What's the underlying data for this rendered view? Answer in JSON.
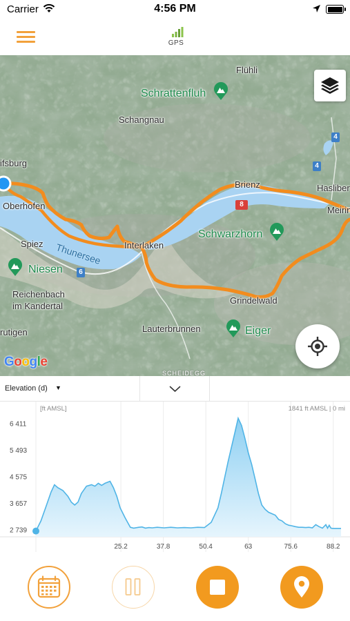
{
  "status_bar": {
    "carrier": "Carrier",
    "time": "4:56 PM"
  },
  "nav": {
    "gps_label": "GPS",
    "accent_color": "#f2a13b"
  },
  "map": {
    "attribution": "Google",
    "places": [
      {
        "id": "fluhli",
        "label": "Flühli"
      },
      {
        "id": "schangnau",
        "label": "Schangnau"
      },
      {
        "id": "sigriswil",
        "label": "ifsburg"
      },
      {
        "id": "oberhofen",
        "label": "Oberhofen"
      },
      {
        "id": "spiez",
        "label": "Spiez"
      },
      {
        "id": "interlaken",
        "label": "Interlaken"
      },
      {
        "id": "brienz",
        "label": "Brienz"
      },
      {
        "id": "hasliberg",
        "label": "Hasliber"
      },
      {
        "id": "meiringen",
        "label": "Meirin"
      },
      {
        "id": "reichenbach",
        "label": "Reichenbach\nim Kandertal"
      },
      {
        "id": "frutigen",
        "label": "rutigen"
      },
      {
        "id": "grindelwald",
        "label": "Grindelwald"
      },
      {
        "id": "lauterbrunnen",
        "label": "Lauterbrunnen"
      },
      {
        "id": "grosse-scheidegg",
        "label": "SCHEIDEGG"
      }
    ],
    "peaks": [
      {
        "id": "schrattenfluh",
        "label": "Schrattenfluh"
      },
      {
        "id": "schwarzhorn",
        "label": "Schwarzhorn"
      },
      {
        "id": "niesen",
        "label": "Niesen"
      },
      {
        "id": "eiger",
        "label": "Eiger"
      }
    ],
    "lake_label": "Thunersee",
    "road_shields": [
      {
        "id": "road-8",
        "label": "8"
      },
      {
        "id": "road-6",
        "label": "6"
      },
      {
        "id": "road-4a",
        "label": "4"
      },
      {
        "id": "road-4b",
        "label": "4"
      }
    ],
    "track_color": "#f28c1e",
    "icons": {
      "layers": "layers-icon",
      "locate": "crosshair-icon",
      "peak": "mountain-icon"
    }
  },
  "controls": {
    "graph_select_label": "Elevation (d)",
    "graph_select_arrow": "▼",
    "collapse_icon": "chevron-down-icon"
  },
  "chart_data": {
    "type": "area",
    "title": "",
    "unit_label": "[ft AMSL]",
    "readout": "1841 ft AMSL | 0 mi",
    "xlabel": "",
    "ylabel": "",
    "xlim": [
      0,
      90.5
    ],
    "ylim": [
      2500,
      6650
    ],
    "y_ticks": [
      2739,
      3657,
      4575,
      5493,
      6411
    ],
    "y_tick_labels": [
      "2 739",
      "3 657",
      "4 575",
      "5 493",
      "6 411"
    ],
    "x_ticks": [
      25.2,
      37.8,
      50.4,
      63,
      75.6,
      88.2
    ],
    "x_tick_labels": [
      "25.2",
      "37.8",
      "50.4",
      "63",
      "75.6",
      "88.2"
    ],
    "grid": "vertical",
    "line_color": "#4fb4e6",
    "fill_color": "#bfe4f7",
    "start_marker": {
      "x": 0,
      "y": 2700
    },
    "series": [
      {
        "x": [
          0,
          1.5,
          3,
          4.5,
          5.5,
          6.5,
          8,
          9.5,
          10.5,
          11.5,
          12.5,
          13.5,
          15,
          16.5,
          17.5,
          18.5,
          19.5,
          20.5,
          22,
          23,
          24,
          25,
          26.5,
          28,
          29,
          30.5,
          31.5,
          32.5,
          33.5,
          34.5,
          36,
          38,
          40,
          42,
          44,
          46,
          48,
          50,
          52,
          54,
          55,
          56,
          57,
          58,
          59,
          60,
          61,
          62,
          63,
          64,
          65,
          66,
          67,
          68,
          69,
          70,
          71,
          72,
          73,
          74,
          75,
          76,
          77,
          78,
          79,
          80,
          81,
          82,
          83,
          84,
          85,
          86,
          86.5,
          87,
          87.5,
          88,
          89,
          90.5
        ],
        "y": [
          2700,
          3050,
          3550,
          4050,
          4300,
          4200,
          4100,
          3900,
          3700,
          3600,
          3700,
          4000,
          4250,
          4300,
          4250,
          4350,
          4280,
          4350,
          4420,
          4200,
          3900,
          3500,
          3150,
          2830,
          2800,
          2830,
          2840,
          2800,
          2820,
          2810,
          2830,
          2810,
          2830,
          2810,
          2820,
          2810,
          2830,
          2820,
          3000,
          3500,
          4000,
          4550,
          5100,
          5600,
          6100,
          6600,
          6350,
          5900,
          5400,
          5000,
          4500,
          4000,
          3600,
          3450,
          3350,
          3300,
          3250,
          3100,
          3050,
          2950,
          2900,
          2880,
          2850,
          2830,
          2830,
          2820,
          2830,
          2810,
          2920,
          2850,
          2800,
          2920,
          2800,
          2900,
          2800,
          2790,
          2790,
          2790
        ]
      }
    ]
  },
  "actions": {
    "calendar_icon": "calendar-icon",
    "pause_icon": "pause-icon",
    "stop_icon": "stop-icon",
    "waypoint_icon": "map-pin-icon",
    "accent": "#f29a1f"
  }
}
